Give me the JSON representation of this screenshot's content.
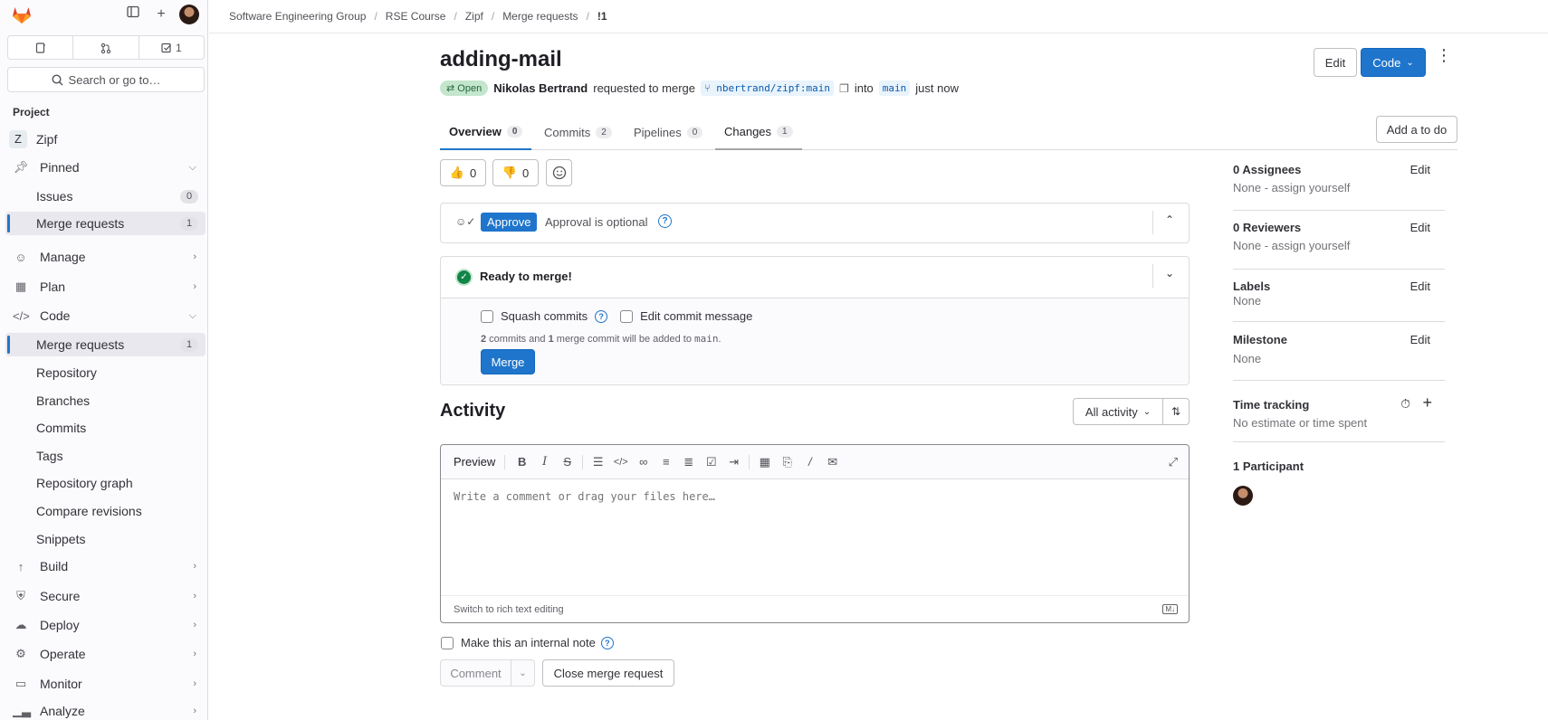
{
  "sidebar": {
    "counter_mr_badge": "1",
    "search_placeholder": "Search or go to…",
    "section_label": "Project",
    "project": {
      "avatar_letter": "Z",
      "name": "Zipf"
    },
    "items": {
      "pinned": "Pinned",
      "issues": "Issues",
      "issues_count": "0",
      "pinned_mr": "Merge requests",
      "pinned_mr_count": "1",
      "manage": "Manage",
      "plan": "Plan",
      "code": "Code",
      "code_mr": "Merge requests",
      "code_mr_count": "1",
      "repository": "Repository",
      "branches": "Branches",
      "commits": "Commits",
      "tags": "Tags",
      "repo_graph": "Repository graph",
      "compare": "Compare revisions",
      "snippets": "Snippets",
      "build": "Build",
      "secure": "Secure",
      "deploy": "Deploy",
      "operate": "Operate",
      "monitor": "Monitor",
      "analyze": "Analyze"
    }
  },
  "breadcrumb": [
    "Software Engineering Group",
    "RSE Course",
    "Zipf",
    "Merge requests",
    "!1"
  ],
  "mr": {
    "title": "adding-mail",
    "edit_label": "Edit",
    "code_label": "Code",
    "status": "Open",
    "author": "Nikolas Bertrand",
    "requested_text": "requested to merge",
    "source_branch": "nbertrand/zipf:main",
    "into_text": "into",
    "target_branch": "main",
    "time": "just now"
  },
  "tabs": [
    {
      "label": "Overview",
      "count": "0"
    },
    {
      "label": "Commits",
      "count": "2"
    },
    {
      "label": "Pipelines",
      "count": "0"
    },
    {
      "label": "Changes",
      "count": "1"
    }
  ],
  "todo_label": "Add a to do",
  "reactions": {
    "thumbs_up": "0",
    "thumbs_down": "0"
  },
  "approval": {
    "button": "Approve",
    "text": "Approval is optional"
  },
  "merge_widget": {
    "title": "Ready to merge!",
    "squash_label": "Squash commits",
    "edit_msg_label": "Edit commit message",
    "summary_commits": "2",
    "summary_mid1": " commits and ",
    "summary_merge": "1",
    "summary_mid2": " merge commit will be added to ",
    "summary_branch": "main",
    "summary_end": ".",
    "merge_button": "Merge"
  },
  "activity": {
    "title": "Activity",
    "filter_label": "All activity",
    "preview_tab": "Preview",
    "placeholder": "Write a comment or drag your files here…",
    "switch_text": "Switch to rich text editing",
    "md_badge": "M↓",
    "internal_note": "Make this an internal note",
    "comment_button": "Comment",
    "close_button": "Close merge request"
  },
  "right_sidebar": {
    "assignees_title": "0 Assignees",
    "assignees_value": "None - assign yourself",
    "reviewers_title": "0 Reviewers",
    "reviewers_value": "None - assign yourself",
    "labels_title": "Labels",
    "labels_value": "None",
    "milestone_title": "Milestone",
    "milestone_value": "None",
    "time_title": "Time tracking",
    "time_value": "No estimate or time spent",
    "participants_title": "1 Participant",
    "edit_label": "Edit"
  },
  "colors": {
    "accent": "#1f75cb",
    "success": "#108548",
    "open_badge_bg": "#c3e6cd"
  }
}
